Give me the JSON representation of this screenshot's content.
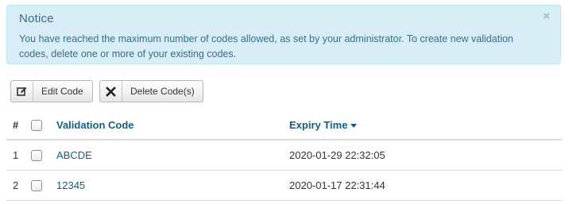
{
  "notice": {
    "title": "Notice",
    "close": "×",
    "message": "You have reached the maximum number of codes allowed, as set by your administrator. To create new validation codes, delete one or more of your existing codes."
  },
  "toolbar": {
    "edit_label": "Edit Code",
    "delete_label": "Delete Code(s)"
  },
  "table": {
    "headers": {
      "num": "#",
      "code": "Validation Code",
      "expiry": "Expiry Time"
    },
    "sort": {
      "column": "expiry",
      "direction": "descending"
    },
    "rows": [
      {
        "num": "1",
        "code": "ABCDE",
        "expiry": "2020-01-29 22:32:05",
        "checked": false
      },
      {
        "num": "2",
        "code": "12345",
        "expiry": "2020-01-17 22:31:44",
        "checked": false
      }
    ]
  },
  "colors": {
    "notice_bg": "#d9edf7",
    "notice_text": "#31708f",
    "link": "#0e5f8c"
  }
}
